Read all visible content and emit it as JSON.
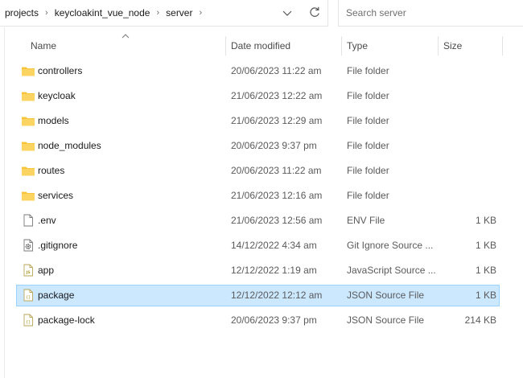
{
  "address": {
    "breadcrumbs": [
      "projects",
      "keycloakint_vue_node",
      "server"
    ],
    "separator": "›"
  },
  "search": {
    "placeholder": "Search server"
  },
  "columns": {
    "name": "Name",
    "date": "Date modified",
    "type": "Type",
    "size": "Size"
  },
  "colors": {
    "folder": "#f8c53a",
    "selection": "#cce8ff",
    "selection_border": "#99d1ff"
  },
  "files": [
    {
      "icon": "folder-icon",
      "name": "controllers",
      "date": "20/06/2023 11:22 am",
      "type": "File folder",
      "size": "",
      "selected": false
    },
    {
      "icon": "folder-icon",
      "name": "keycloak",
      "date": "21/06/2023 12:22 am",
      "type": "File folder",
      "size": "",
      "selected": false
    },
    {
      "icon": "folder-icon",
      "name": "models",
      "date": "21/06/2023 12:29 am",
      "type": "File folder",
      "size": "",
      "selected": false
    },
    {
      "icon": "folder-icon",
      "name": "node_modules",
      "date": "20/06/2023 9:37 pm",
      "type": "File folder",
      "size": "",
      "selected": false
    },
    {
      "icon": "folder-icon",
      "name": "routes",
      "date": "20/06/2023 11:22 am",
      "type": "File folder",
      "size": "",
      "selected": false
    },
    {
      "icon": "folder-icon",
      "name": "services",
      "date": "21/06/2023 12:16 am",
      "type": "File folder",
      "size": "",
      "selected": false
    },
    {
      "icon": "blank-file-icon",
      "name": ".env",
      "date": "21/06/2023 12:56 am",
      "type": "ENV File",
      "size": "1 KB",
      "selected": false
    },
    {
      "icon": "gear-file-icon",
      "name": ".gitignore",
      "date": "14/12/2022 4:34 am",
      "type": "Git Ignore Source ...",
      "size": "1 KB",
      "selected": false
    },
    {
      "icon": "js-file-icon",
      "name": "app",
      "date": "12/12/2022 1:19 am",
      "type": "JavaScript Source ...",
      "size": "1 KB",
      "selected": false
    },
    {
      "icon": "json-file-icon",
      "name": "package",
      "date": "12/12/2022 12:12 am",
      "type": "JSON Source File",
      "size": "1 KB",
      "selected": true
    },
    {
      "icon": "json-file-icon",
      "name": "package-lock",
      "date": "20/06/2023 9:37 pm",
      "type": "JSON Source File",
      "size": "214 KB",
      "selected": false
    }
  ]
}
